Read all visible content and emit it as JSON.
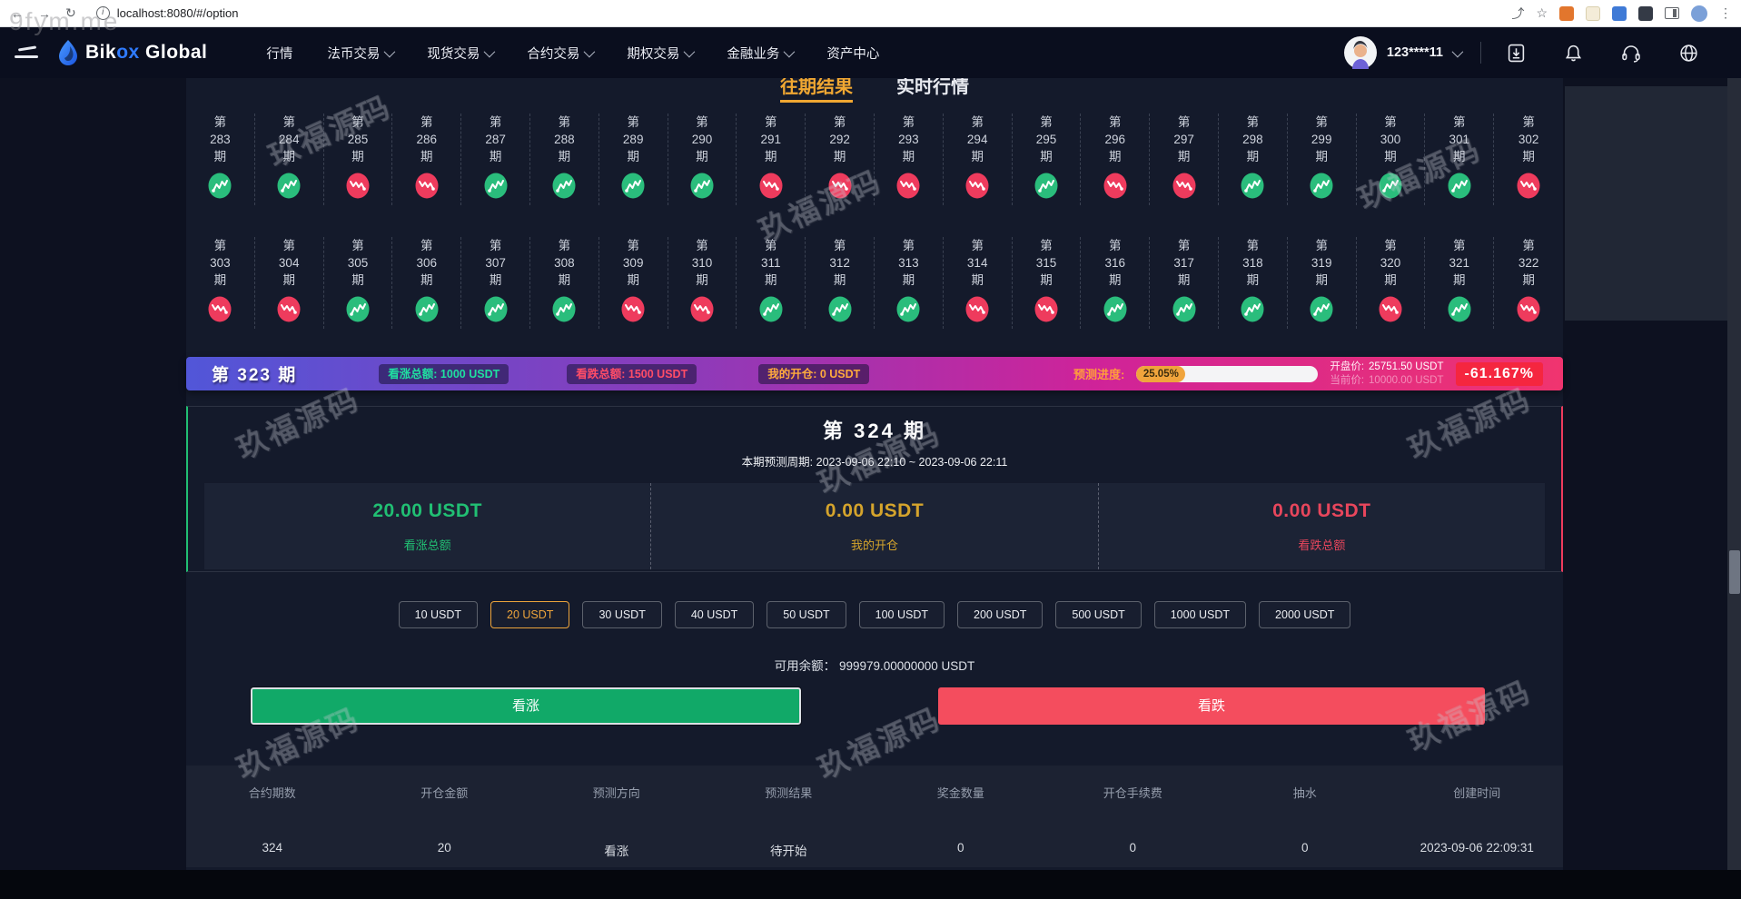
{
  "browser": {
    "url": "localhost:8080/#/option",
    "icons": [
      "back-arrow",
      "forward-arrow",
      "refresh",
      "site-info",
      "share",
      "star",
      "extension-orange",
      "extension-light",
      "extension-blue",
      "extension-dark",
      "split-view",
      "profile",
      "menu-dots"
    ]
  },
  "navbar": {
    "brand": {
      "part1": "Bik",
      "part2": "ox",
      "part3": " Global",
      "logo_icon": "blue-flame"
    },
    "menu": [
      {
        "label": "行情",
        "caret": false
      },
      {
        "label": "法币交易",
        "caret": true
      },
      {
        "label": "现货交易",
        "caret": true
      },
      {
        "label": "合约交易",
        "caret": true
      },
      {
        "label": "期权交易",
        "caret": true
      },
      {
        "label": "金融业务",
        "caret": true
      },
      {
        "label": "资产中心",
        "caret": false
      }
    ],
    "username": "123****11",
    "right_icons": [
      "avatar",
      "chevron-down",
      "download",
      "bell",
      "headset",
      "globe"
    ]
  },
  "tabs": [
    {
      "label": "往期结果",
      "active": true
    },
    {
      "label": "实时行情",
      "active": false
    }
  ],
  "history": {
    "prefix": "第",
    "suffix": "期",
    "row1": [
      {
        "n": "283",
        "dir": "up"
      },
      {
        "n": "284",
        "dir": "up"
      },
      {
        "n": "285",
        "dir": "down"
      },
      {
        "n": "286",
        "dir": "down"
      },
      {
        "n": "287",
        "dir": "up"
      },
      {
        "n": "288",
        "dir": "up"
      },
      {
        "n": "289",
        "dir": "up"
      },
      {
        "n": "290",
        "dir": "up"
      },
      {
        "n": "291",
        "dir": "down"
      },
      {
        "n": "292",
        "dir": "down"
      },
      {
        "n": "293",
        "dir": "down"
      },
      {
        "n": "294",
        "dir": "down"
      },
      {
        "n": "295",
        "dir": "up"
      },
      {
        "n": "296",
        "dir": "down"
      },
      {
        "n": "297",
        "dir": "down"
      },
      {
        "n": "298",
        "dir": "up"
      },
      {
        "n": "299",
        "dir": "up"
      },
      {
        "n": "300",
        "dir": "up"
      },
      {
        "n": "301",
        "dir": "up"
      },
      {
        "n": "302",
        "dir": "down"
      }
    ],
    "row2": [
      {
        "n": "303",
        "dir": "down"
      },
      {
        "n": "304",
        "dir": "down"
      },
      {
        "n": "305",
        "dir": "up"
      },
      {
        "n": "306",
        "dir": "up"
      },
      {
        "n": "307",
        "dir": "up"
      },
      {
        "n": "308",
        "dir": "up"
      },
      {
        "n": "309",
        "dir": "down"
      },
      {
        "n": "310",
        "dir": "down"
      },
      {
        "n": "311",
        "dir": "up"
      },
      {
        "n": "312",
        "dir": "up"
      },
      {
        "n": "313",
        "dir": "up"
      },
      {
        "n": "314",
        "dir": "down"
      },
      {
        "n": "315",
        "dir": "down"
      },
      {
        "n": "316",
        "dir": "up"
      },
      {
        "n": "317",
        "dir": "up"
      },
      {
        "n": "318",
        "dir": "up"
      },
      {
        "n": "319",
        "dir": "up"
      },
      {
        "n": "320",
        "dir": "down"
      },
      {
        "n": "321",
        "dir": "up"
      },
      {
        "n": "322",
        "dir": "down"
      }
    ]
  },
  "current_round": {
    "title": "第 323 期",
    "bull_label": "看涨总额:",
    "bull_value": "1000 USDT",
    "bear_label": "看跌总额:",
    "bear_value": "1500 USDT",
    "position_label": "我的开仓:",
    "position_value": "0 USDT",
    "progress_label": "预测进度:",
    "progress_value": "25.05%",
    "progress_pct": 25.05,
    "open_label": "开盘价:",
    "open_value": "25751.50 USDT",
    "current_label": "当前价:",
    "current_value": "10000.00 USDT",
    "change": "-61.167%"
  },
  "next_round": {
    "title": "第 324 期",
    "period": "本期预测周期: 2023-09-06 22:10 ~ 2023-09-06 22:11",
    "stats": [
      {
        "value": "20.00 USDT",
        "label": "看涨总额",
        "color": "green"
      },
      {
        "value": "0.00 USDT",
        "label": "我的开仓",
        "color": "yellow"
      },
      {
        "value": "0.00 USDT",
        "label": "看跌总额",
        "color": "red"
      }
    ]
  },
  "amounts": {
    "options": [
      "10 USDT",
      "20 USDT",
      "30 USDT",
      "40 USDT",
      "50 USDT",
      "100 USDT",
      "200 USDT",
      "500 USDT",
      "1000 USDT",
      "2000 USDT"
    ],
    "selected_index": 1
  },
  "balance": {
    "label": "可用余额：",
    "value": "999979.00000000 USDT"
  },
  "actions": {
    "bull": "看涨",
    "bear": "看跌"
  },
  "orders": {
    "headers": [
      "合约期数",
      "开仓金额",
      "预测方向",
      "预测结果",
      "奖金数量",
      "开仓手续费",
      "抽水",
      "创建时间"
    ],
    "rows": [
      [
        "324",
        "20",
        "看涨",
        "待开始",
        "0",
        "0",
        "0",
        "2023-09-06 22:09:31"
      ]
    ]
  },
  "watermark": {
    "text": "玖福源码",
    "site": "9fym.me",
    "count": 9
  },
  "colors": {
    "up": "#2abd7c",
    "down": "#ee3b5d",
    "accent": "#f0a732",
    "banner_red": "#f5263f"
  }
}
